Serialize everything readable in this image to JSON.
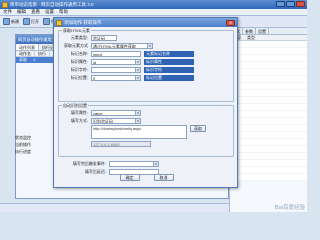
{
  "main": {
    "title": "简单动态指南 - 网页自动操作通用工具 3.0",
    "menus": [
      "文件",
      "编辑",
      "查看",
      "设置",
      "帮助"
    ],
    "toolbar": [
      "新建",
      "打开",
      "保存",
      "运行",
      "停止",
      "设置"
    ]
  },
  "inner": {
    "title": "网页自动操作通用工具 - 项目",
    "tabs": [
      "动作列表",
      "执行记录",
      "日志"
    ],
    "columns": [
      "动作名",
      "执行"
    ],
    "rows": [
      {
        "name": "获取",
        "value": "1"
      }
    ],
    "bottom_labels": [
      "状态监控",
      "当前操作",
      "执行进度"
    ]
  },
  "right_panel": {
    "tabs": [
      "调试",
      "参数",
      "设置"
    ],
    "columns": [
      "内容",
      "类型"
    ]
  },
  "dialog": {
    "title": "添加动作-获取操作",
    "section_basic": "获取HTML元素",
    "element_type_label": "元素类型:",
    "element_type_value": "验证码",
    "find_mode_label": "获取元素方式",
    "find_mode_value": "通过HTML元素属性获取",
    "tag_label": "标记名称:",
    "tag_value": "input",
    "tag_note": "元素标记名称",
    "attr1_label": "标识属性:",
    "attr1_value": "id",
    "attr1_note": "标识属性",
    "attr2_label": "标识字符:",
    "attr2_value": "",
    "attr2_note": "标识字符",
    "index_label": "标记位置:",
    "index_value": "0",
    "index_note": "标记位置",
    "section_auto": "自动识别设置",
    "fill_attr_label": "填写属性:",
    "fill_attr_value": "value",
    "fill_type_label": "填写方式:",
    "fill_type_value": "识别验证码",
    "url_value": "http://dummyhost/verify.aspx",
    "fetch_button": "获取",
    "ip_value": "127.0.0.1:8080",
    "fill_event_label": "填写完后触发事件:",
    "fill_event_value": "",
    "fill_extra_label": "填写后延迟:",
    "fill_extra_value": "",
    "ok_button": "确定",
    "cancel_button": "取消"
  },
  "watermark": "Bai百度经验"
}
